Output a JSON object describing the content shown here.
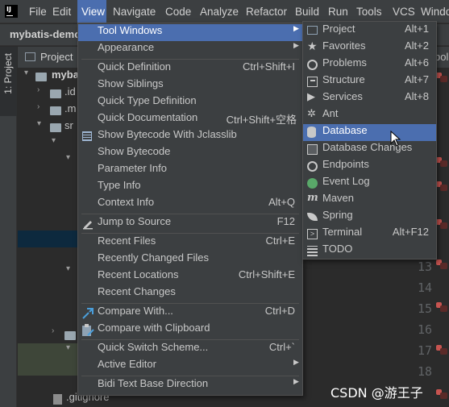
{
  "menubar": {
    "items": [
      "File",
      "Edit",
      "View",
      "Navigate",
      "Code",
      "Analyze",
      "Refactor",
      "Build",
      "Run",
      "Tools",
      "VCS",
      "Windo"
    ],
    "open_item": "View"
  },
  "navbar": {
    "project": "mybatis-demo"
  },
  "side_stripe": {
    "project_tab": "1: Project"
  },
  "project_panel": {
    "title": "Project",
    "tree": [
      "myba",
      ".id",
      ".m",
      "sr",
      ".gitignore"
    ]
  },
  "editor": {
    "tab_label": "pol",
    "line_numbers": [
      "13",
      "14",
      "15",
      "16",
      "17",
      "18"
    ]
  },
  "view_menu": {
    "items": [
      {
        "label": "Tool Windows",
        "shortcut": "",
        "submenu": true
      },
      {
        "label": "Appearance",
        "shortcut": "",
        "submenu": true
      },
      {
        "label": "Quick Definition",
        "shortcut": "Ctrl+Shift+I"
      },
      {
        "label": "Show Siblings",
        "shortcut": ""
      },
      {
        "label": "Quick Type Definition",
        "shortcut": ""
      },
      {
        "label": "Quick Documentation",
        "shortcut": "Ctrl+Shift+空格"
      },
      {
        "label": "Show Bytecode With Jclasslib",
        "shortcut": ""
      },
      {
        "label": "Show Bytecode",
        "shortcut": ""
      },
      {
        "label": "Parameter Info",
        "shortcut": ""
      },
      {
        "label": "Type Info",
        "shortcut": ""
      },
      {
        "label": "Context Info",
        "shortcut": "Alt+Q"
      },
      {
        "label": "Jump to Source",
        "shortcut": "F12"
      },
      {
        "label": "Recent Files",
        "shortcut": "Ctrl+E"
      },
      {
        "label": "Recently Changed Files",
        "shortcut": ""
      },
      {
        "label": "Recent Locations",
        "shortcut": "Ctrl+Shift+E"
      },
      {
        "label": "Recent Changes",
        "shortcut": ""
      },
      {
        "label": "Compare With...",
        "shortcut": "Ctrl+D"
      },
      {
        "label": "Compare with Clipboard",
        "shortcut": ""
      },
      {
        "label": "Quick Switch Scheme...",
        "shortcut": "Ctrl+`"
      },
      {
        "label": "Active Editor",
        "shortcut": "",
        "submenu": true
      },
      {
        "label": "Bidi Text Base Direction",
        "shortcut": "",
        "submenu": true
      }
    ]
  },
  "tool_windows_menu": {
    "items": [
      {
        "label": "Project",
        "shortcut": "Alt+1"
      },
      {
        "label": "Favorites",
        "shortcut": "Alt+2"
      },
      {
        "label": "Problems",
        "shortcut": "Alt+6"
      },
      {
        "label": "Structure",
        "shortcut": "Alt+7"
      },
      {
        "label": "Services",
        "shortcut": "Alt+8"
      },
      {
        "label": "Ant",
        "shortcut": ""
      },
      {
        "label": "Database",
        "shortcut": ""
      },
      {
        "label": "Database Changes",
        "shortcut": ""
      },
      {
        "label": "Endpoints",
        "shortcut": ""
      },
      {
        "label": "Event Log",
        "shortcut": ""
      },
      {
        "label": "Maven",
        "shortcut": ""
      },
      {
        "label": "Spring",
        "shortcut": ""
      },
      {
        "label": "Terminal",
        "shortcut": "Alt+F12"
      },
      {
        "label": "TODO",
        "shortcut": ""
      }
    ],
    "selected": "Database"
  },
  "watermark": "CSDN @游王子",
  "colors": {
    "selection": "#4b6eaf",
    "menu_bg": "#3c3f41",
    "editor_bg": "#2b2b2b"
  }
}
